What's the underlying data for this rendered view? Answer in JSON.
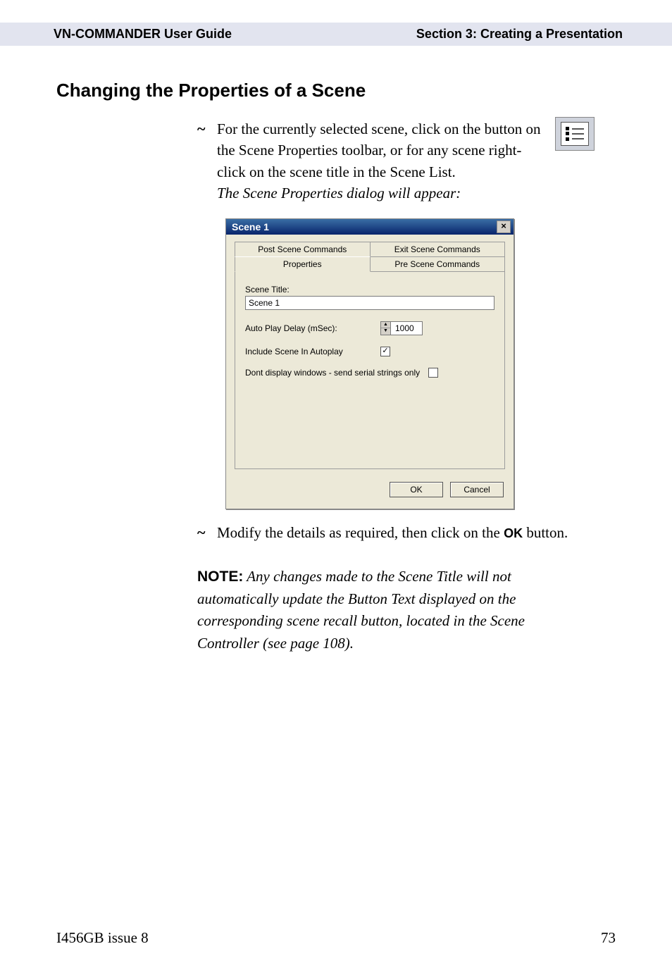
{
  "header": {
    "left": "VN-COMMANDER User Guide",
    "right": "Section 3: Creating a Presentation"
  },
  "section_title": "Changing the Properties of a Scene",
  "step1": {
    "line1": "For the currently selected scene, click on the",
    "line2": "button on the Scene Properties toolbar, or for any scene right-click on the scene title in the Scene List.",
    "line3_italic": "The Scene Properties dialog will appear:"
  },
  "dialog": {
    "title": "Scene 1",
    "close": "×",
    "tabs": {
      "post": "Post Scene Commands",
      "exit": "Exit Scene Commands",
      "properties": "Properties",
      "pre": "Pre Scene Commands"
    },
    "scene_title_label": "Scene Title:",
    "scene_title_value": "Scene 1",
    "autoplay_delay_label": "Auto Play Delay (mSec):",
    "autoplay_delay_value": "1000",
    "include_label": "Include Scene In Autoplay",
    "include_checked": "✓",
    "dont_display_label": "Dont display windows - send serial strings only",
    "dont_display_checked": "",
    "ok": "OK",
    "cancel": "Cancel"
  },
  "step2": {
    "prefix": "Modify the details as required, then click on the ",
    "ok_label": "OK",
    "suffix": " button."
  },
  "note": {
    "label": "NOTE:",
    "text": " Any changes made to the Scene Title will not automatically update the Button Text displayed on the corresponding scene recall button, located in the Scene Controller (see page 108)."
  },
  "footer": {
    "left": "I456GB issue 8",
    "right": "73"
  }
}
